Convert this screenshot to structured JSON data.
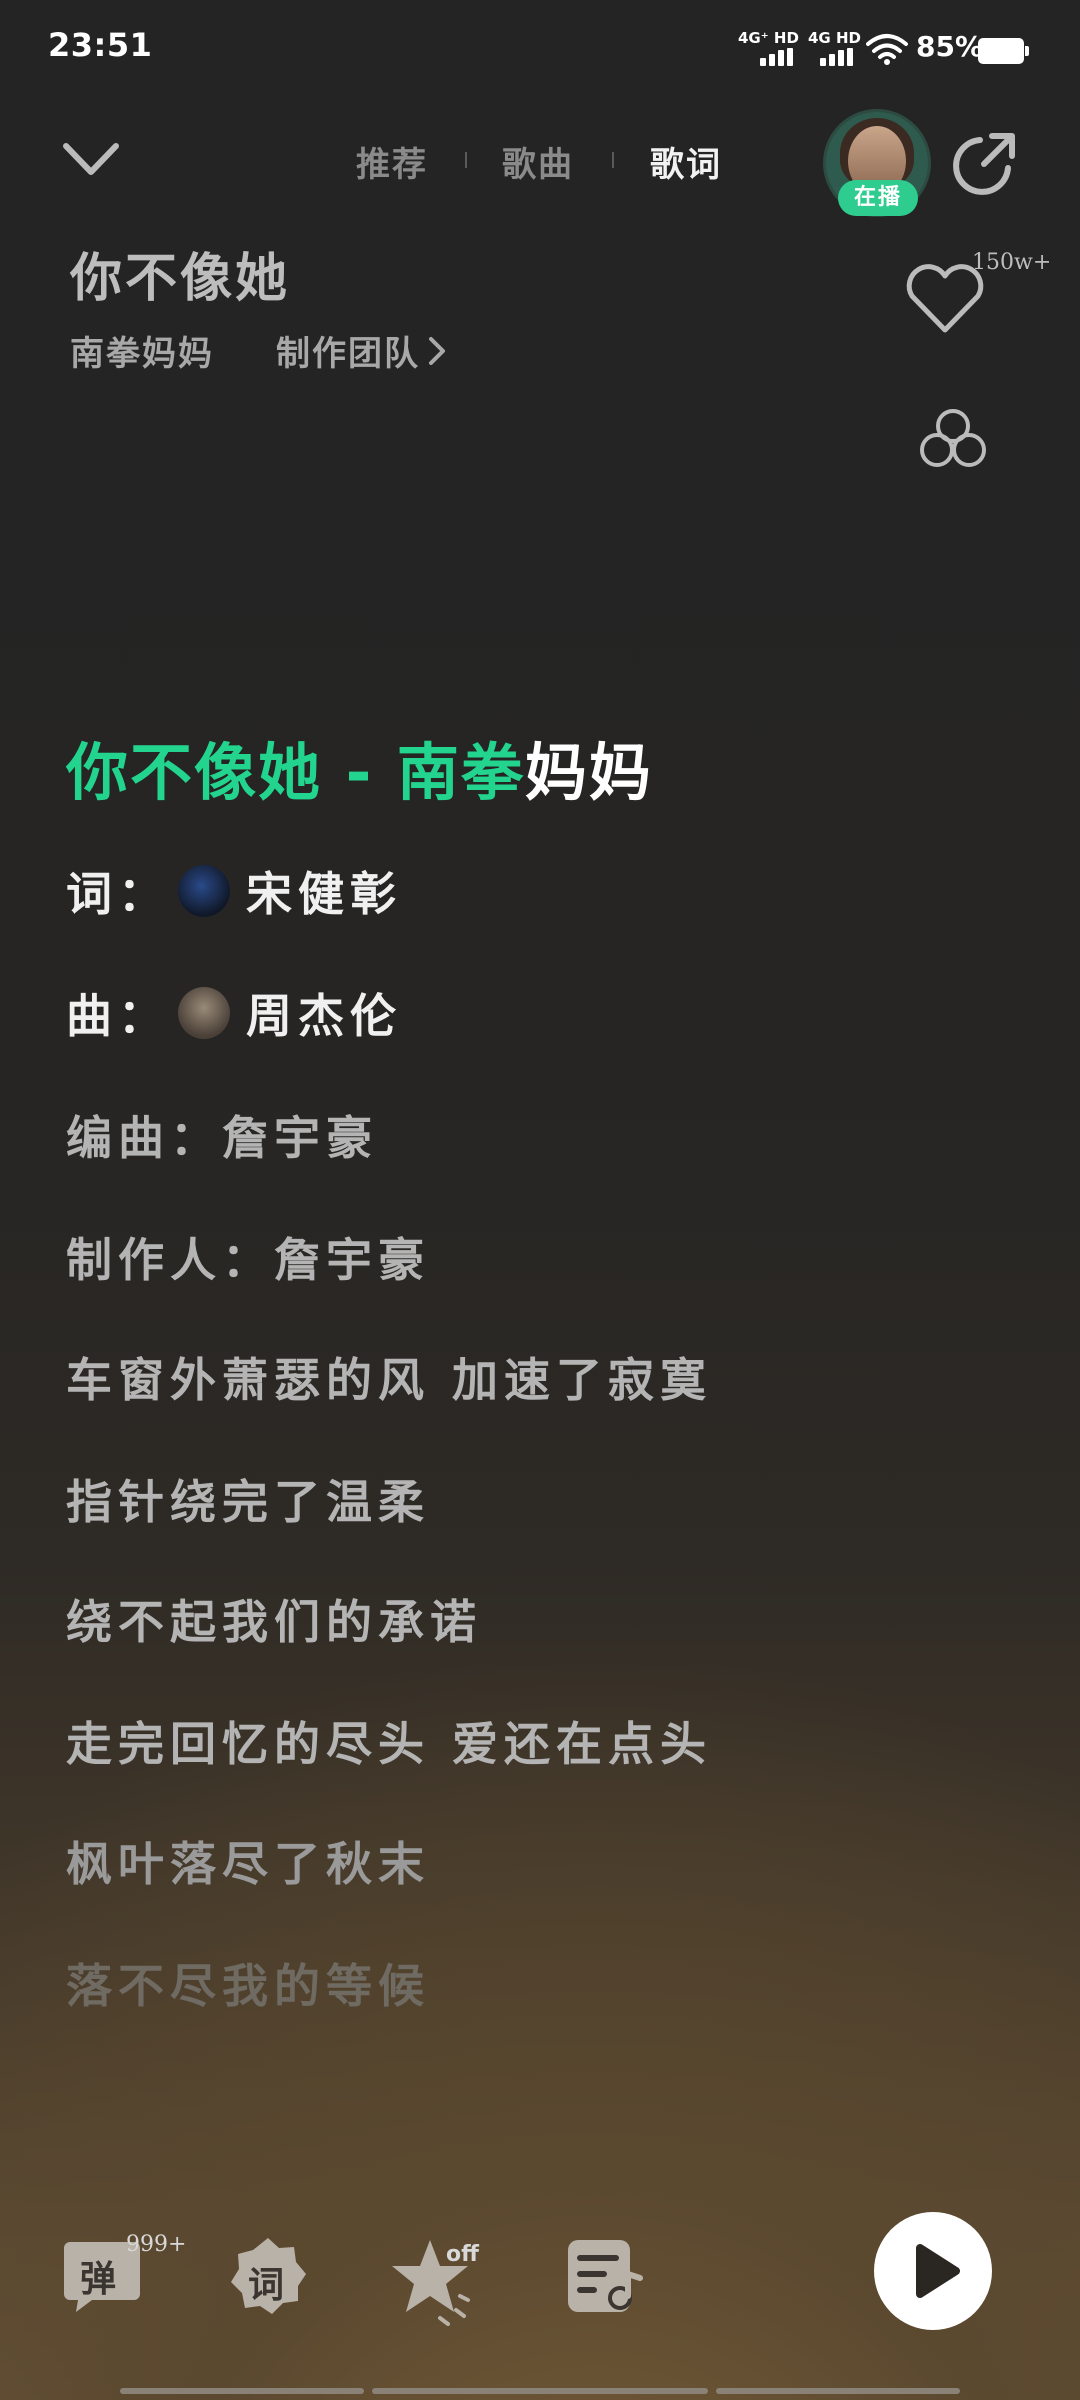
{
  "status_bar": {
    "time": "23:51",
    "net1_top": "4G⁺ HD",
    "net2_top": "4G HD",
    "battery_percent": "85%",
    "battery_level": 0.85
  },
  "header": {
    "tabs": [
      "推荐",
      "歌曲",
      "歌词"
    ],
    "active_tab": "歌词",
    "now_playing_badge": "在播"
  },
  "song": {
    "title": "你不像她",
    "artist": "南拳妈妈",
    "team_link": "制作团队",
    "like_count": "150w+"
  },
  "lyrics": {
    "current_sung": "你不像她 - 南拳",
    "current_unsung": "妈妈",
    "lyricist_label": "词：",
    "lyricist": "宋健彰",
    "composer_label": "曲：",
    "composer": "周杰伦",
    "lines": [
      "编曲：詹宇豪",
      "制作人：詹宇豪",
      "车窗外萧瑟的风 加速了寂寞",
      "指针绕完了温柔",
      "绕不起我们的承诺",
      "走完回忆的尽头 爱还在点头",
      "枫叶落尽了秋末",
      "落不尽我的等候"
    ]
  },
  "bottom_bar": {
    "danmu_label": "弹",
    "danmu_count": "999+",
    "lyric_label": "词",
    "star_status": "off"
  },
  "colors": {
    "accent_green": "#22d48e",
    "badge_green": "#2ecc8f"
  },
  "icons": [
    "collapse-chevron-icon",
    "share-icon",
    "heart-icon",
    "clover-icon",
    "danmu-icon",
    "lyric-icon",
    "star-icon",
    "playlist-icon",
    "play-icon",
    "wifi-icon",
    "battery-icon"
  ]
}
